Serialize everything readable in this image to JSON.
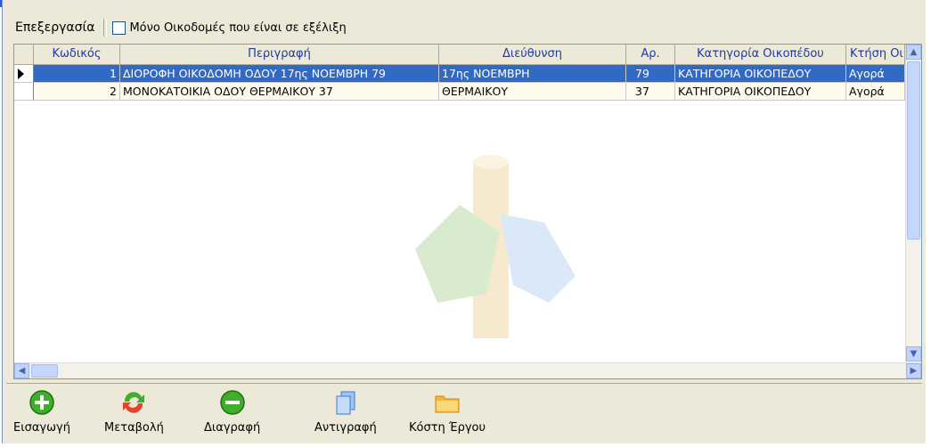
{
  "toolbar": {
    "edit_label": "Επεξεργασία",
    "only_active_label": "Μόνο Οικοδομές που είναι σε εξέλιξη"
  },
  "grid": {
    "columns": [
      "Κωδικός",
      "Περιγραφή",
      "Διεύθυνση",
      "Αρ.",
      "Κατηγορία Οικοπέδου",
      "Κτήση Οι"
    ],
    "rows": [
      {
        "code": "1",
        "description": "ΔΙΟΡΟΦΗ ΟΙΚΟΔΟΜΗ ΟΔΟΥ 17ης ΝΟΕΜΒΡΗ 79",
        "address": "17ης ΝΟΕΜΒΡΗ",
        "number": "79",
        "category": "ΚΑΤΗΓΟΡΙΑ ΟΙΚΟΠΕΔΟΥ",
        "acquisition": "Αγορά"
      },
      {
        "code": "2",
        "description": "ΜΟΝΟΚΑΤΟΙΚΙΑ ΟΔΟΥ ΘΕΡΜΑΙΚΟΥ 37",
        "address": "ΘΕΡΜΑΙΚΟΥ",
        "number": "37",
        "category": "ΚΑΤΗΓΟΡΙΑ ΟΙΚΟΠΕΔΟΥ",
        "acquisition": "Αγορά"
      }
    ]
  },
  "actions": {
    "insert": "Εισαγωγή",
    "modify": "Μεταβολή",
    "delete": "Διαγραφή",
    "copy": "Αντιγραφή",
    "project_cost": "Κόστη Έργου"
  },
  "colors": {
    "selection": "#316ac5",
    "header_text": "#1f3aa8",
    "panel": "#ece9d8"
  }
}
